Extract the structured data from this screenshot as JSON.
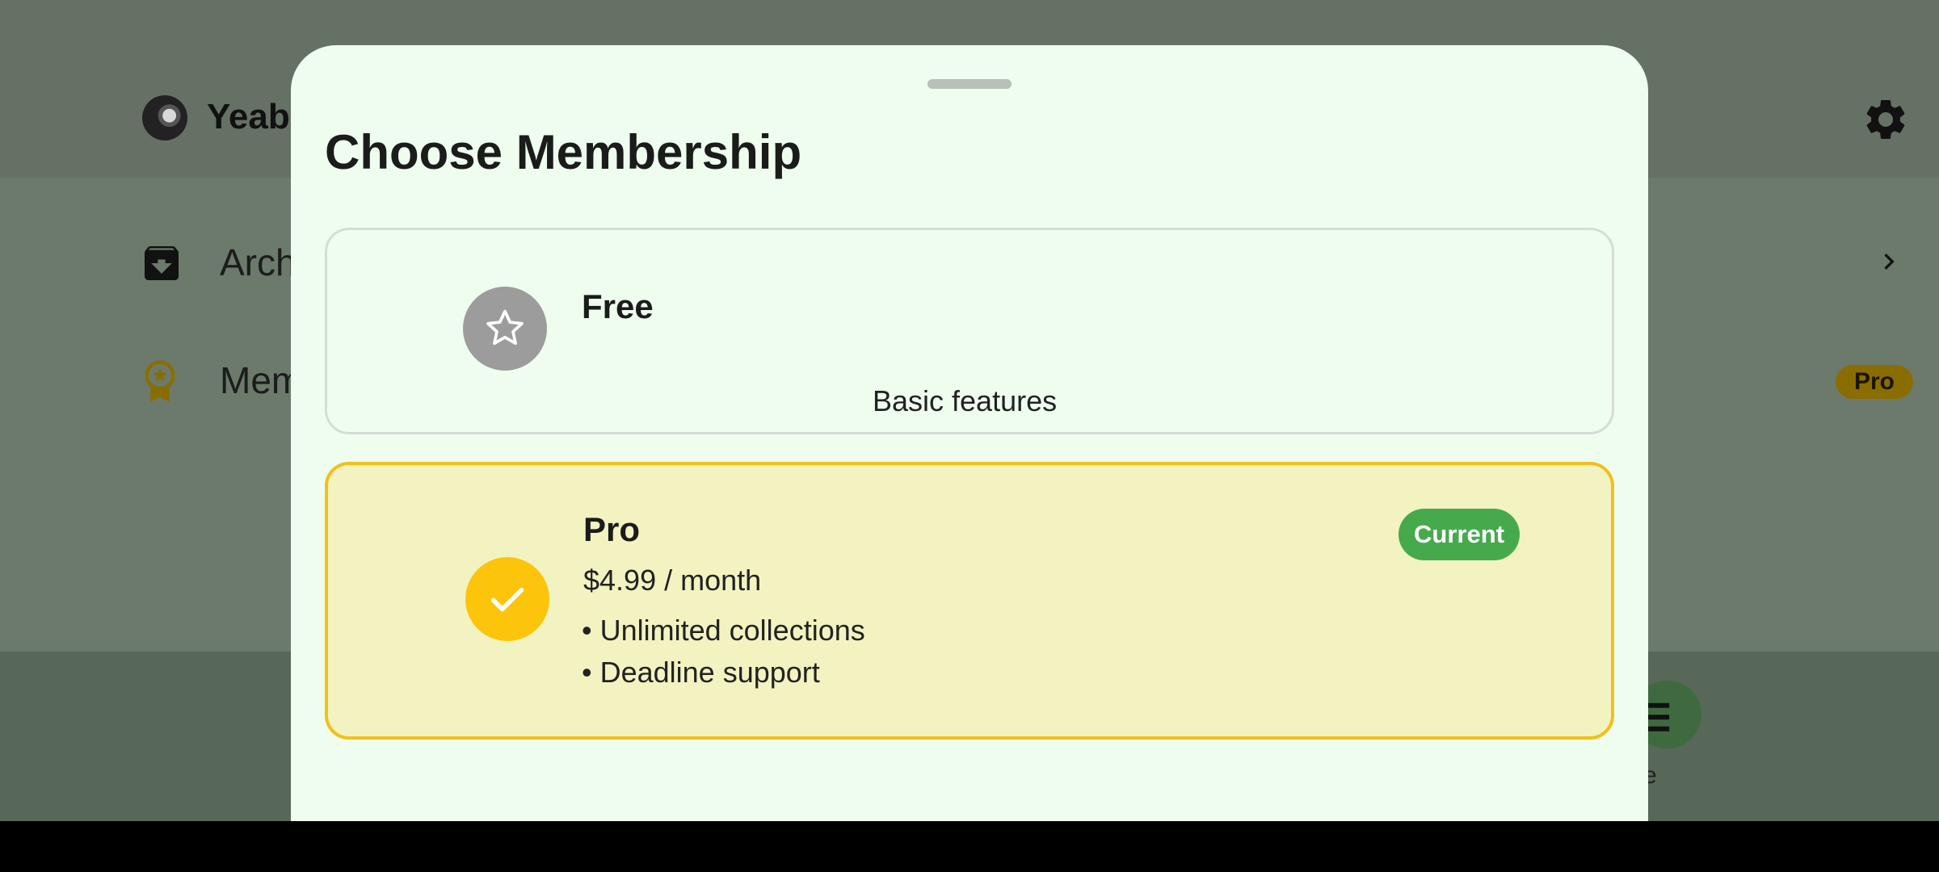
{
  "background_app": {
    "user_name": "Yeabsira",
    "rows": [
      {
        "label": "Archive",
        "icon": "archive-icon"
      },
      {
        "label": "Membership",
        "icon": "award-icon",
        "badge": "Pro"
      }
    ],
    "bottom_nav": {
      "visible_label": "re"
    }
  },
  "sheet": {
    "title": "Choose Membership",
    "plans": [
      {
        "name": "Free",
        "subtitle": "Basic features",
        "icon": "star-icon",
        "icon_color": "#9c9c9c"
      },
      {
        "name": "Pro",
        "price": "$4.99 / month",
        "features": [
          "• Unlimited collections",
          "• Deadline support"
        ],
        "icon": "check-icon",
        "icon_color": "#fdc40c",
        "badge": "Current",
        "selected": true
      }
    ]
  },
  "colors": {
    "accent": "#fdc40c",
    "selected_border": "#f2c01a",
    "selected_fill": "#f3f3c1",
    "current_badge": "#46aa4c",
    "sheet_bg": "#effdef"
  }
}
